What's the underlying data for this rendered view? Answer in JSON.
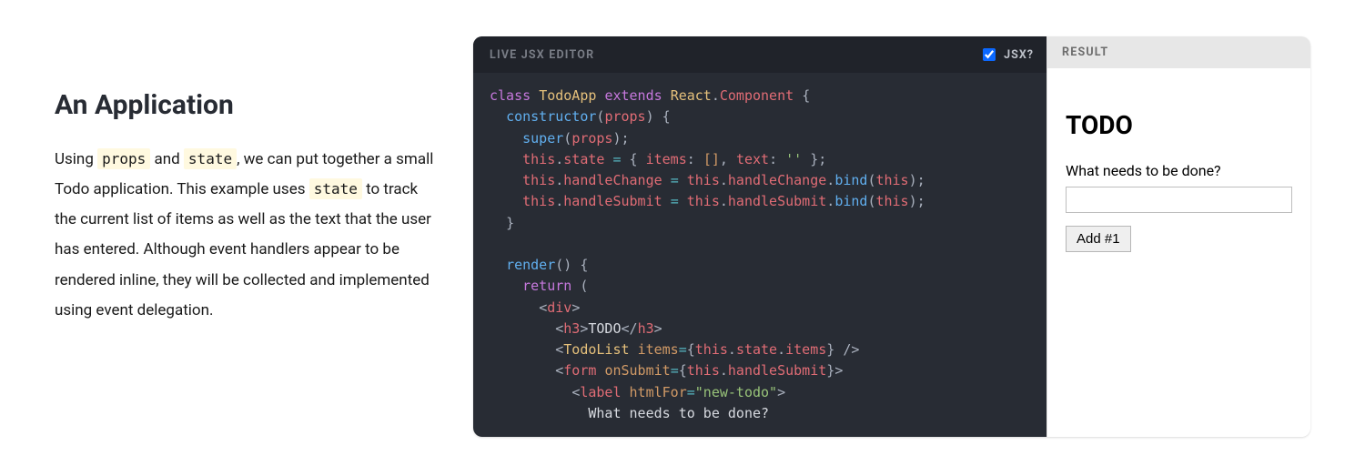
{
  "prose": {
    "heading": "An Application",
    "p_before_props": "Using ",
    "code_props": "props",
    "p_between_props_state": " and ",
    "code_state1": "state",
    "p_after_state1": ", we can put together a small Todo application. This example uses ",
    "code_state2": "state",
    "p_after_state2": " to track the current list of items as well as the text that the user has entered. Although event handlers appear to be rendered inline, they will be collected and implemented using event delegation."
  },
  "editor": {
    "title": "LIVE JSX EDITOR",
    "jsx_label": "JSX?",
    "jsx_checked": true
  },
  "code": {
    "class_kw": "class",
    "app_name": "TodoApp",
    "extends_kw": "extends",
    "react": "React",
    "component": "Component",
    "constructor": "constructor",
    "props": "props",
    "super": "super",
    "this": "this",
    "state_prop": "state",
    "items_prop": "items",
    "text_prop": "text",
    "empty_str": "''",
    "handleChange": "handleChange",
    "handleSubmit": "handleSubmit",
    "bind": "bind",
    "render": "render",
    "return_kw": "return",
    "tag_div": "div",
    "tag_h3": "h3",
    "todo_text": "TODO",
    "tag_todolist": "TodoList",
    "attr_items": "items",
    "tag_form": "form",
    "attr_onSubmit": "onSubmit",
    "tag_label": "label",
    "attr_htmlFor": "htmlFor",
    "new_todo_str": "\"new-todo\"",
    "label_text": "What needs to be done?"
  },
  "result": {
    "header": "RESULT",
    "todo_heading": "TODO",
    "input_label": "What needs to be done?",
    "input_value": "",
    "button_label": "Add #1"
  }
}
